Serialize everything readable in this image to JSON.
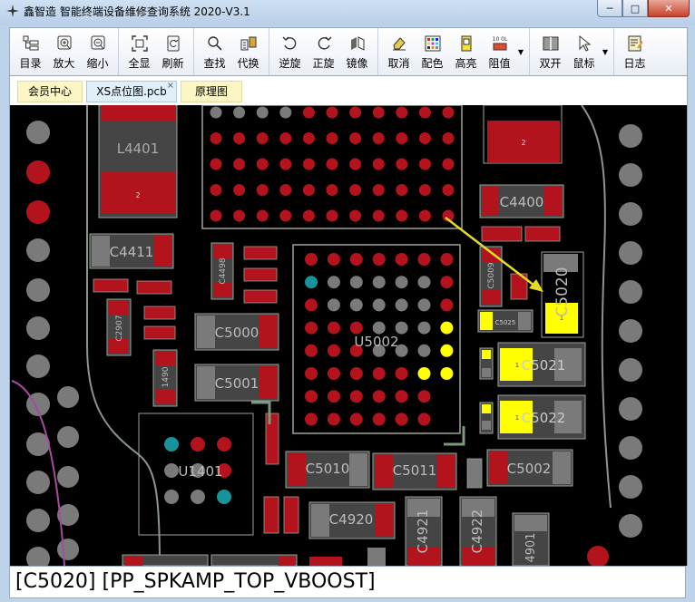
{
  "window": {
    "title": "鑫智造 智能终端设备维修查询系统 2020-V3.1",
    "minimize": "─",
    "maximize": "□",
    "close": "✕"
  },
  "toolbar": {
    "buttons": [
      {
        "label": "目录",
        "icon": "directory-icon"
      },
      {
        "label": "放大",
        "icon": "zoom-in-icon"
      },
      {
        "label": "缩小",
        "icon": "zoom-out-icon"
      },
      {
        "label": "全显",
        "icon": "fit-all-icon"
      },
      {
        "label": "刷新",
        "icon": "refresh-icon"
      },
      {
        "label": "查找",
        "icon": "search-icon"
      },
      {
        "label": "代换",
        "icon": "replace-icon"
      },
      {
        "label": "逆旋",
        "icon": "rotate-ccw-icon"
      },
      {
        "label": "正旋",
        "icon": "rotate-cw-icon"
      },
      {
        "label": "镜像",
        "icon": "mirror-icon"
      },
      {
        "label": "取消",
        "icon": "eraser-icon"
      },
      {
        "label": "配色",
        "icon": "palette-icon"
      },
      {
        "label": "高亮",
        "icon": "highlight-icon"
      },
      {
        "label": "阻值",
        "icon": "resistance-icon"
      },
      {
        "label": "双开",
        "icon": "dual-view-icon"
      },
      {
        "label": "鼠标",
        "icon": "cursor-icon"
      },
      {
        "label": "日志",
        "icon": "log-icon"
      }
    ],
    "resistance_icon_text": "10 0L"
  },
  "tabs": [
    {
      "label": "会员中心",
      "active": false
    },
    {
      "label": "XS点位图.pcb",
      "active": true
    },
    {
      "label": "原理图",
      "active": false
    }
  ],
  "tab_close": "×",
  "board": {
    "labels": {
      "L4401": "L4401",
      "C4411": "C4411",
      "C4498": "C4498",
      "C2907": "C2907",
      "C1490": "1490",
      "C5000": "C5000",
      "C5001": "C5001",
      "U5002": "U5002",
      "U1401": "U1401",
      "C4400": "C4400",
      "C5009": "C5009",
      "C5020": "C5020",
      "C5025": "C5025",
      "C5021": "C5021",
      "C5022": "C5022",
      "C5010": "C5010",
      "C5011": "C5011",
      "C5002": "C5002",
      "C4920": "C4920",
      "C4921": "C4921",
      "C4922": "C4922",
      "C4901": "4901"
    },
    "pad_numbers": {
      "one": "1",
      "two": "2"
    },
    "colors": {
      "pad_red": "#b2131c",
      "pad_gray": "#7a7a7a",
      "highlight": "#ffff00",
      "teal": "#17949b",
      "outline": "#9aa39a",
      "arrow": "#e5dc2a"
    }
  },
  "status": {
    "text": "[C5020] [PP_SPKAMP_TOP_VBOOST]"
  }
}
